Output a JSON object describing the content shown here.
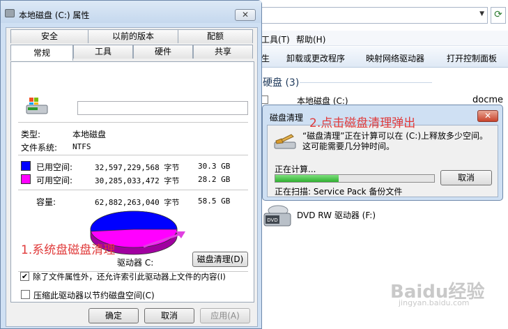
{
  "explorer": {
    "menu": [
      "工具(T)",
      "帮助(H)"
    ],
    "toolbar": [
      "生",
      "卸载或更改程序",
      "映射网络驱动器",
      "打开控制面板"
    ],
    "section": "硬盘 (3)",
    "drive_c": "本地磁盘 (C:)",
    "docme": "docme (",
    "dvd": "DVD RW 驱动器 (F:)",
    "dvd_badge": "DVD"
  },
  "props": {
    "title": "本地磁盘 (C:) 属性",
    "tabs_row1": [
      "安全",
      "以前的版本",
      "配额"
    ],
    "tabs_row2": [
      "常规",
      "工具",
      "硬件",
      "共享"
    ],
    "type_label": "类型:",
    "type_value": "本地磁盘",
    "fs_label": "文件系统:",
    "fs_value": "NTFS",
    "used_label": "已用空间:",
    "used_bytes": "32,597,229,568 字节",
    "used_gb": "30.3 GB",
    "free_label": "可用空间:",
    "free_bytes": "30,285,033,472 字节",
    "free_gb": "28.2 GB",
    "cap_label": "容量:",
    "cap_bytes": "62,882,263,040 字节",
    "cap_gb": "58.5 GB",
    "drive_label": "驱动器 C:",
    "cleanup_button": "磁盘清理(D)",
    "compress_label": "压缩此驱动器以节约磁盘空间(C)",
    "compress_checked": false,
    "index_label": "除了文件属性外，还允许索引此驱动器上文件的内容(I)",
    "index_checked": true,
    "ok": "确定",
    "cancel": "取消",
    "apply": "应用(A)",
    "colors": {
      "used": "#0000ff",
      "free": "#ff00ff"
    }
  },
  "pie": {
    "used_fraction": 0.518
  },
  "cleanup": {
    "title": "磁盘清理",
    "message": "“磁盘清理”正在计算可以在 (C:)上释放多少空间。这可能需要几分钟时间。",
    "computing": "正在计算...",
    "cancel": "取消",
    "scanning": "正在扫描: Service Pack 备份文件",
    "progress": 0.4
  },
  "annotations": {
    "step1": "1.系统盘磁盘清理",
    "step2": "2.点击磁盘清理弹出"
  },
  "watermark": {
    "brand": "Baidu经验",
    "url": "jingyan.baidu.com"
  }
}
